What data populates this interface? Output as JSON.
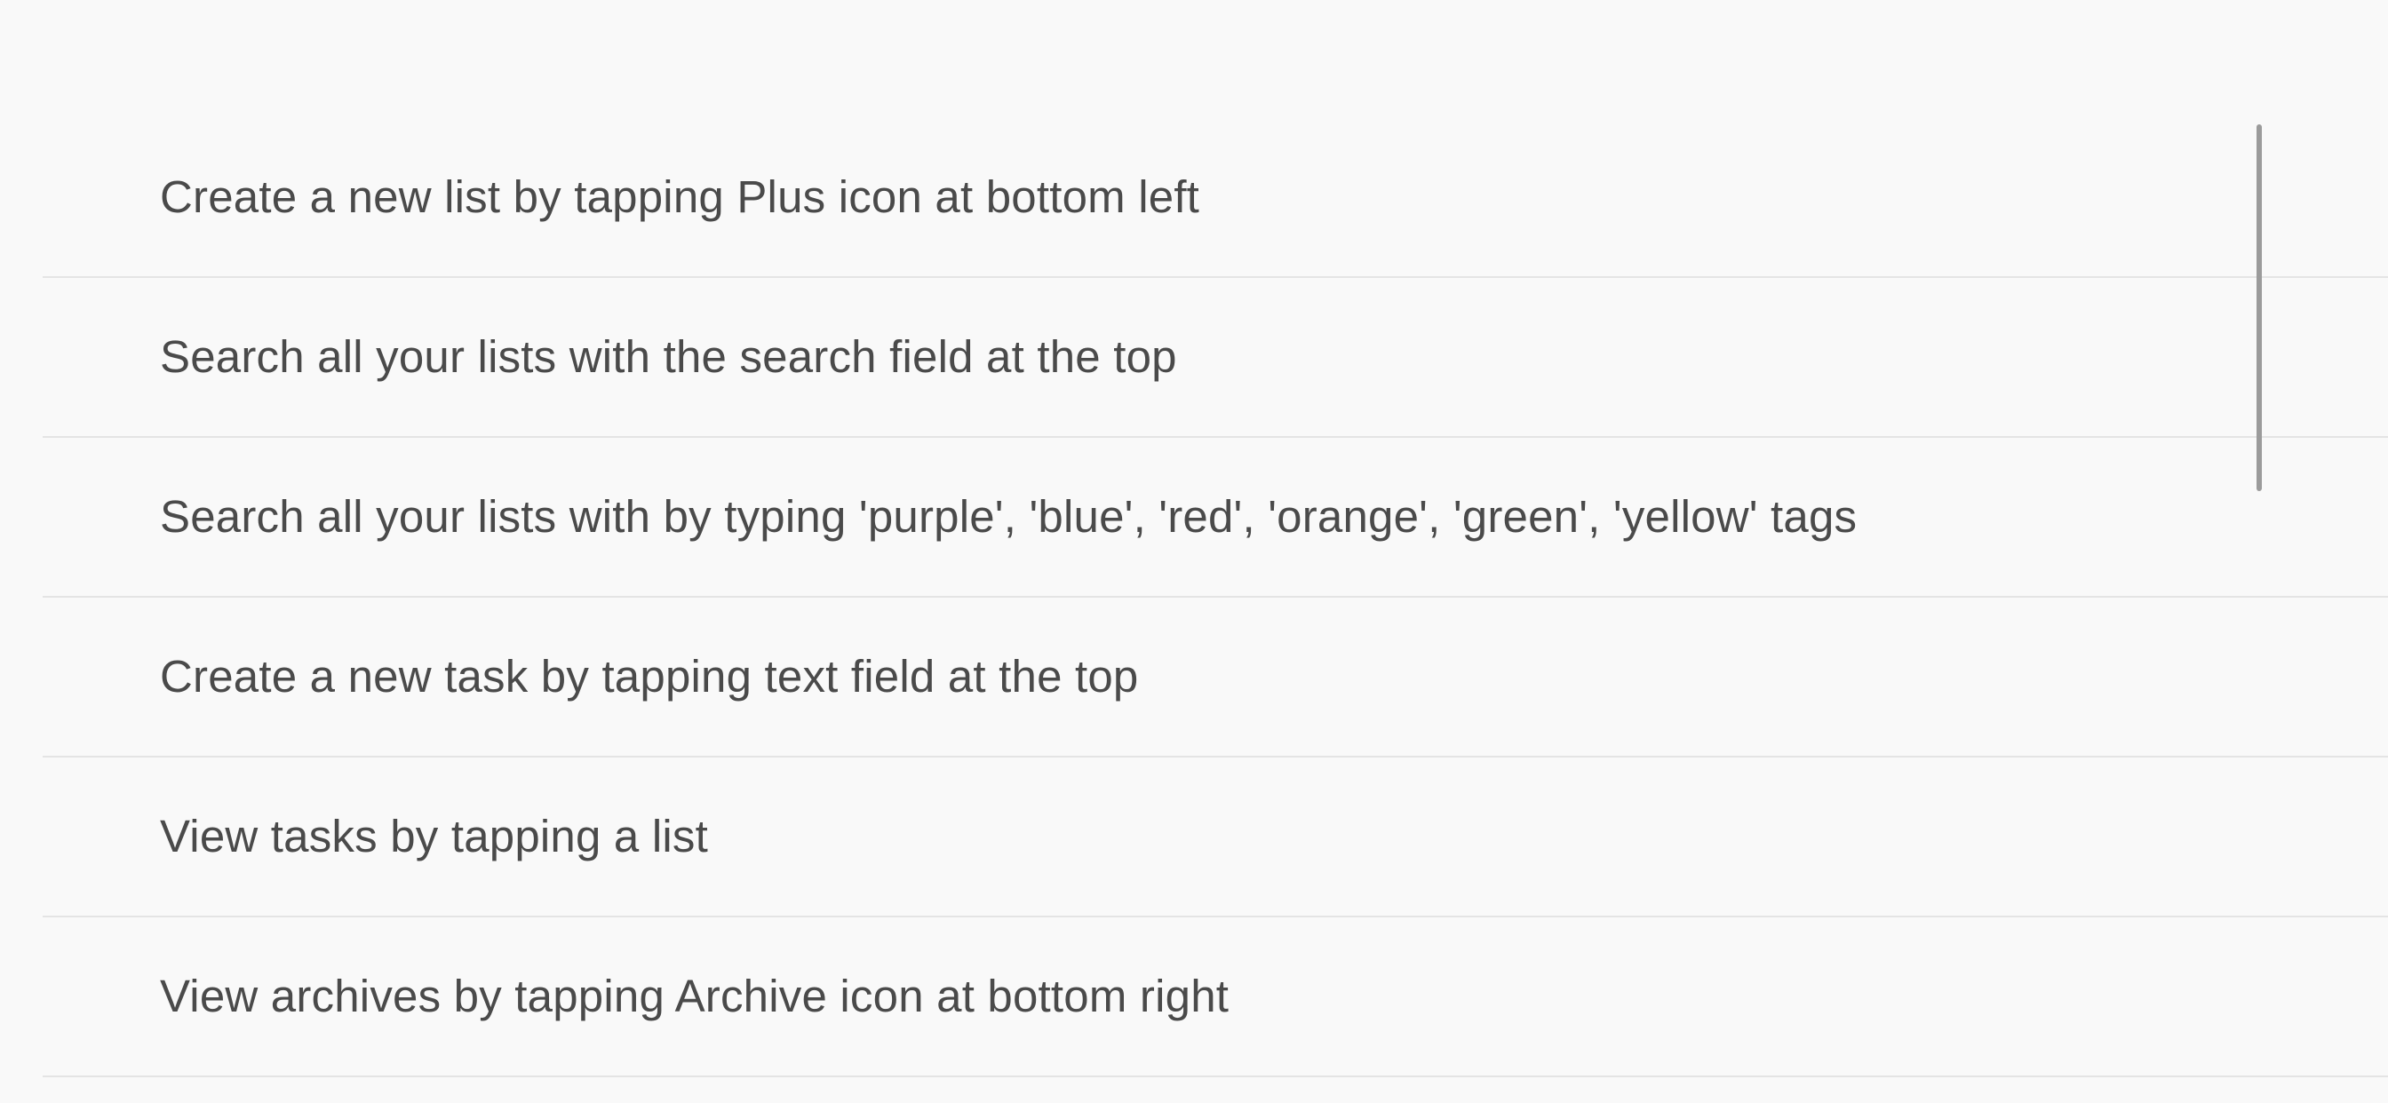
{
  "tips": [
    "Create a new list by tapping Plus icon at bottom left",
    "Search all your lists with the search field at the top",
    "Search all your lists with by typing 'purple', 'blue', 'red', 'orange', 'green', 'yellow' tags",
    "Create a new task by tapping text field at the top",
    "View tasks by tapping a list",
    "View archives by tapping Archive icon at bottom right"
  ],
  "scroll_position": 0
}
